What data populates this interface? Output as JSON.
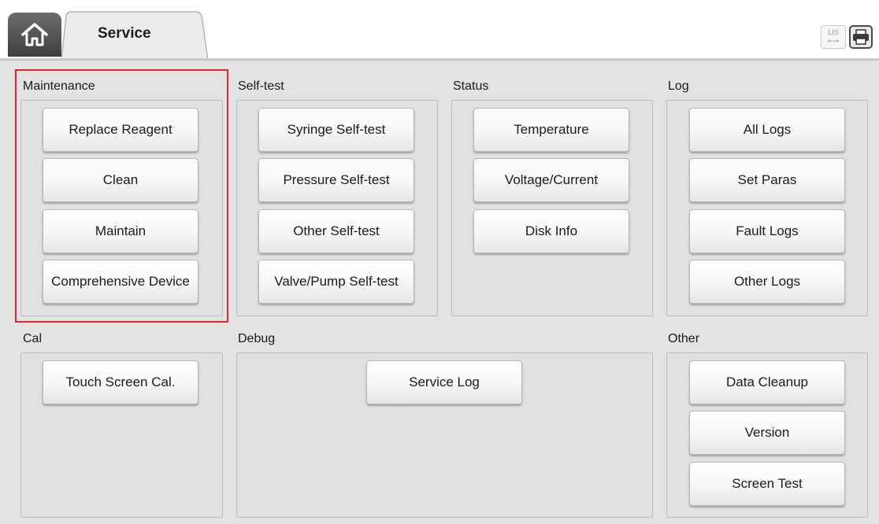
{
  "header": {
    "tab_label": "Service",
    "lis_label": "LIS",
    "lis_arrows": "⇐⇒"
  },
  "sections": {
    "maintenance": {
      "title": "Maintenance",
      "buttons": [
        "Replace Reagent",
        "Clean",
        "Maintain",
        "Comprehensive Device"
      ]
    },
    "selftest": {
      "title": "Self-test",
      "buttons": [
        "Syringe Self-test",
        "Pressure Self-test",
        "Other Self-test",
        "Valve/Pump Self-test"
      ]
    },
    "status": {
      "title": "Status",
      "buttons": [
        "Temperature",
        "Voltage/Current",
        "Disk Info"
      ]
    },
    "log": {
      "title": "Log",
      "buttons": [
        "All Logs",
        "Set Paras",
        "Fault Logs",
        "Other Logs"
      ]
    },
    "cal": {
      "title": "Cal",
      "buttons": [
        "Touch Screen Cal."
      ]
    },
    "debug": {
      "title": "Debug",
      "buttons": [
        "Service Log"
      ]
    },
    "other": {
      "title": "Other",
      "buttons": [
        "Data Cleanup",
        "Version",
        "Screen Test"
      ]
    }
  },
  "colors": {
    "highlight": "#e0262a",
    "background": "#e3e3e3"
  },
  "icons": [
    "home-icon",
    "lis-icon",
    "print-icon"
  ]
}
